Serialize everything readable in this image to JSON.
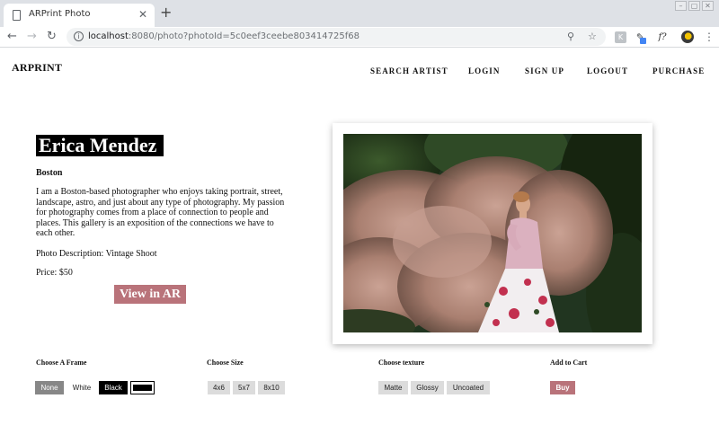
{
  "browser": {
    "tab_title": "ARPrint Photo",
    "url_host": "localhost",
    "url_rest": ":8080/photo?photoId=5c0eef3ceebe803414725f68",
    "extension_f_label": "f?",
    "extension_k_label": "K"
  },
  "site": {
    "brand": "ARPRINT",
    "nav": [
      "SEARCH ARTIST",
      "LOGIN",
      "SIGN UP",
      "LOGOUT",
      "PURCHASE"
    ]
  },
  "artist": {
    "name": "Erica Mendez",
    "city": "Boston",
    "bio": "I am a Boston-based photographer who enjoys taking portrait, street, landscape, astro, and just about any type of photography. My passion for photography comes from a place of connection to people and places. This gallery is an exposition of the connections we have to each other.",
    "description_label": "Photo Description:",
    "description": "Vintage Shoot",
    "price_label": "Price:",
    "price": "$50",
    "view_ar_label": "View in AR"
  },
  "options": {
    "frame": {
      "title": "Choose A Frame",
      "buttons": [
        "None",
        "White",
        "Black"
      ]
    },
    "size": {
      "title": "Choose Size",
      "buttons": [
        "4x6",
        "5x7",
        "8x10"
      ]
    },
    "texture": {
      "title": "Choose texture",
      "buttons": [
        "Matte",
        "Glossy",
        "Uncoated"
      ]
    },
    "cart": {
      "title": "Add to Cart",
      "buy_label": "Buy"
    }
  },
  "colors": {
    "accent": "#b9737a",
    "artist_badge": "#000000",
    "selected_frame": "#878787"
  },
  "icons": [
    "document-icon",
    "close-icon",
    "plus-icon",
    "back-arrow-icon",
    "forward-arrow-icon",
    "reload-icon",
    "info-icon",
    "zoom-icon",
    "star-icon",
    "menu-dots-icon"
  ]
}
